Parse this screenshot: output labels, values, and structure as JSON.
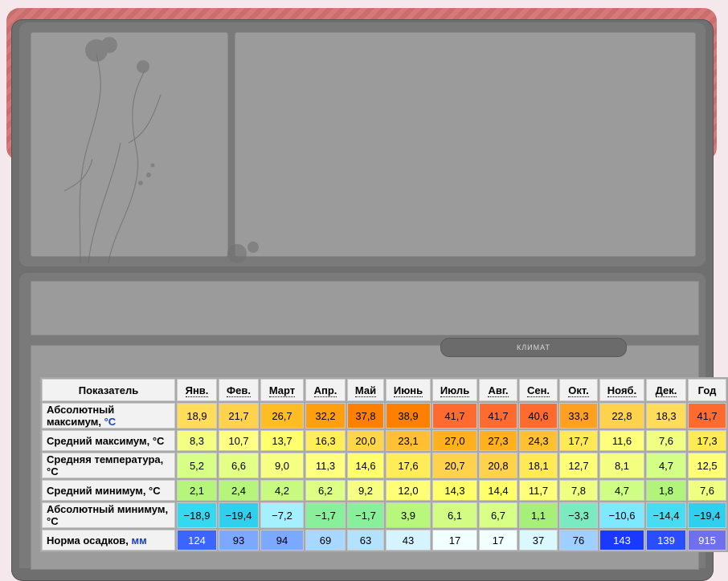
{
  "climate_label": "Климат",
  "table": {
    "header": [
      "Показатель",
      "Янв.",
      "Фев.",
      "Март",
      "Апр.",
      "Май",
      "Июнь",
      "Июль",
      "Авг.",
      "Сен.",
      "Окт.",
      "Нояб.",
      "Дек.",
      "Год"
    ],
    "rows": [
      {
        "label": "Абсолютный максимум,",
        "unit": "°C",
        "values": [
          "18,9",
          "21,7",
          "26,7",
          "32,2",
          "37,8",
          "38,9",
          "41,7",
          "41,7",
          "40,6",
          "33,3",
          "22,8",
          "18,3",
          "41,7"
        ],
        "colors": [
          "#ffdc5a",
          "#ffd24e",
          "#ffbc23",
          "#ff9f10",
          "#ff8000",
          "#ff8000",
          "#ff6a2e",
          "#ff6a2e",
          "#ff6a2e",
          "#ffa020",
          "#ffd24e",
          "#ffdc5a",
          "#ff6a2e"
        ]
      },
      {
        "label": "Средний максимум, °C",
        "unit": "",
        "values": [
          "8,3",
          "10,7",
          "13,7",
          "16,3",
          "20,0",
          "23,1",
          "27,0",
          "27,3",
          "24,3",
          "17,7",
          "11,6",
          "7,6",
          "17,3"
        ],
        "colors": [
          "#f2ff82",
          "#ffff86",
          "#ffff6e",
          "#ffee5a",
          "#ffd64a",
          "#ffc033",
          "#ffb01c",
          "#ffb01c",
          "#ffc033",
          "#ffea55",
          "#ffff7a",
          "#f0ff84",
          "#ffea55"
        ]
      },
      {
        "label": "Средняя температура, °C",
        "unit": "",
        "values": [
          "5,2",
          "6,6",
          "9,0",
          "11,3",
          "14,6",
          "17,6",
          "20,7",
          "20,8",
          "18,1",
          "12,7",
          "8,1",
          "4,7",
          "12,5"
        ],
        "colors": [
          "#d8ff85",
          "#e4ff86",
          "#f6ff82",
          "#ffff80",
          "#ffff6c",
          "#ffec58",
          "#ffd24c",
          "#ffd24c",
          "#ffea55",
          "#ffff76",
          "#f4ff82",
          "#d4ff86",
          "#ffff76"
        ]
      },
      {
        "label": "Средний минимум, °C",
        "unit": "",
        "values": [
          "2,1",
          "2,4",
          "4,2",
          "6,2",
          "9,2",
          "12,0",
          "14,3",
          "14,4",
          "11,7",
          "7,8",
          "4,7",
          "1,8",
          "7,6"
        ],
        "colors": [
          "#b4f57a",
          "#b4f57a",
          "#c8fa80",
          "#dcff84",
          "#f6ff82",
          "#ffff78",
          "#ffff6a",
          "#ffff6a",
          "#ffff7a",
          "#eeff82",
          "#ceff84",
          "#b0f47a",
          "#eeff82"
        ]
      },
      {
        "label": "Абсолютный минимум, °C",
        "unit": "",
        "values": [
          "−18,9",
          "−19,4",
          "−7,2",
          "−1,7",
          "−1,7",
          "3,9",
          "6,1",
          "6,7",
          "1,1",
          "−3,3",
          "−10,6",
          "−14,4",
          "−19,4"
        ],
        "colors": [
          "#34d8f0",
          "#2ed0ee",
          "#a4f0ff",
          "#88f09a",
          "#88f09a",
          "#b8f67c",
          "#d2fc84",
          "#d8ff86",
          "#a6f07a",
          "#7aeac0",
          "#7ee8ff",
          "#48dcf2",
          "#2ed0ee"
        ]
      },
      {
        "label": "Норма осадков,",
        "unit": "мм",
        "values": [
          "124",
          "93",
          "94",
          "69",
          "63",
          "43",
          "17",
          "17",
          "37",
          "76",
          "143",
          "139",
          "915"
        ],
        "colors": [
          "#3c64ff",
          "#7ca8ff",
          "#7ca8ff",
          "#a8d8ff",
          "#b2e2ff",
          "#d6f4ff",
          "#f2ffff",
          "#f2ffff",
          "#dcf8ff",
          "#a0ceff",
          "#1a38ff",
          "#2c4cff",
          "#7070ee"
        ]
      }
    ]
  },
  "colors": {
    "page_bg": "#f4e8ec",
    "frame": "#6f6f6f",
    "panel": "#7a7a7a",
    "tile": "#9b9b9b",
    "unit_blue": "#1a3fb8"
  }
}
